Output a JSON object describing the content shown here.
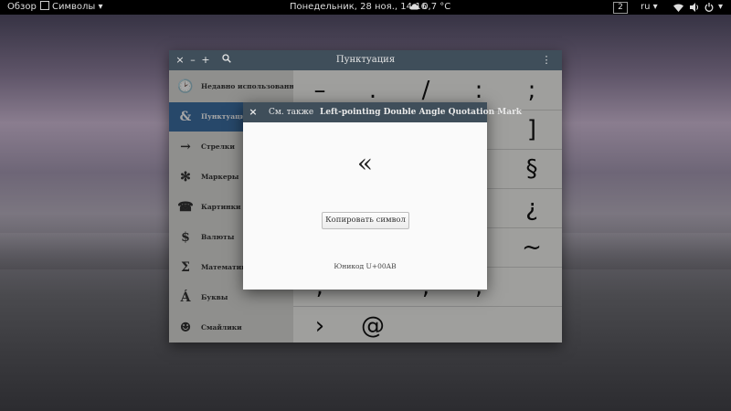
{
  "topbar": {
    "activities": "Обзор",
    "app_icon": "grid-icon",
    "app_name": "Символы",
    "app_arrow": "▾",
    "clock": "Понедельник, 28 ноя., 14:16",
    "weather_icon": "cloud-icon",
    "weather": "0,7 °C",
    "workspace": "2",
    "language": "ru",
    "language_arrow": "▾",
    "network_icon": "wifi-icon",
    "volume_icon": "speaker-icon",
    "power_icon": "power-icon",
    "power_arrow": "▾"
  },
  "window": {
    "title": "Пунктуация",
    "close": "×",
    "minimize": "–",
    "add": "+",
    "search_icon": "search-icon",
    "menu_icon": "kebab-icon",
    "menu_glyph": "⋮"
  },
  "sidebar": {
    "items": [
      {
        "icon": "🕑",
        "label": "Недавно использованные"
      },
      {
        "icon": "&",
        "label": "Пунктуация"
      },
      {
        "icon": "→",
        "label": "Стрелки"
      },
      {
        "icon": "✻",
        "label": "Маркеры"
      },
      {
        "icon": "☎",
        "label": "Картинки"
      },
      {
        "icon": "$",
        "label": "Валюты"
      },
      {
        "icon": "Σ",
        "label": "Математика"
      },
      {
        "icon": "Á",
        "label": "Буквы"
      },
      {
        "icon": "☻",
        "label": "Смайлики"
      }
    ],
    "active_index": 1
  },
  "grid": {
    "rows": [
      [
        "–",
        ".",
        "/",
        ":",
        ";"
      ],
      [
        "",
        "",
        "",
        "",
        "]"
      ],
      [
        "",
        "",
        "",
        "",
        "§"
      ],
      [
        "",
        "",
        "",
        "",
        "¿"
      ],
      [
        "",
        "",
        "",
        "",
        "~"
      ],
      [
        ";",
        "·",
        ",",
        ",",
        ""
      ],
      [
        "›",
        "@",
        "",
        "",
        ""
      ]
    ]
  },
  "dialog": {
    "close": "×",
    "see_also": "См. также",
    "title": "Left-pointing Double Angle Quotation Mark",
    "glyph": "«",
    "copy_button": "Копировать символ",
    "unicode": "Юникод U+00AB"
  }
}
